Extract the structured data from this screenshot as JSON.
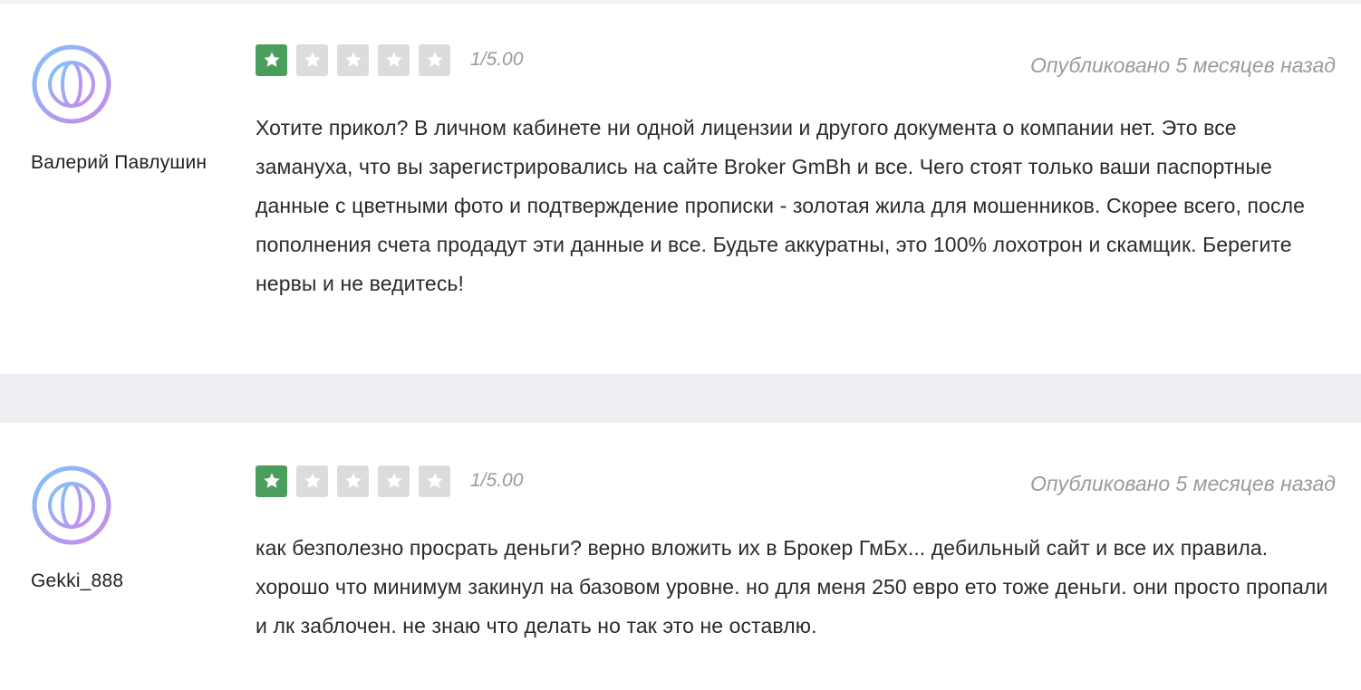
{
  "reviews": [
    {
      "author": "Валерий Павлушин",
      "score": "1/5.00",
      "rating": 1,
      "max_rating": 5,
      "published": "Опубликовано 5 месяцев назад",
      "text": "Хотите прикол? В личном кабинете ни одной лицензии и другого документа о компании нет. Это все замануха, что вы зарегистрировались на сайте Broker GmBh и все. Чего стоят только ваши паспортные данные с цветными фото и подтверждение прописки - золотая жила для мошенников. Скорее всего, после пополнения счета продадут эти данные и все. Будьте аккуратны, это 100% лохотрон и скамщик. Берегите нервы и не ведитесь!"
    },
    {
      "author": "Gekki_888",
      "score": "1/5.00",
      "rating": 1,
      "max_rating": 5,
      "published": "Опубликовано 5 месяцев назад",
      "text": "как безполезно просрать деньги? верно вложить их в Брокер ГмБх... дебильный сайт и все их правила. хорошо что минимум закинул на базовом уровне. но для меня 250 евро ето тоже деньги. они просто пропали и лк заблочен. не знаю что делать но так это не оставлю."
    }
  ],
  "colors": {
    "star_filled": "#4a9e5c",
    "star_empty": "#dcdcde",
    "separator": "#eceef2",
    "muted_text": "#9a9aa0"
  },
  "icons": {
    "avatar": "globe-icon",
    "star": "star-icon"
  }
}
